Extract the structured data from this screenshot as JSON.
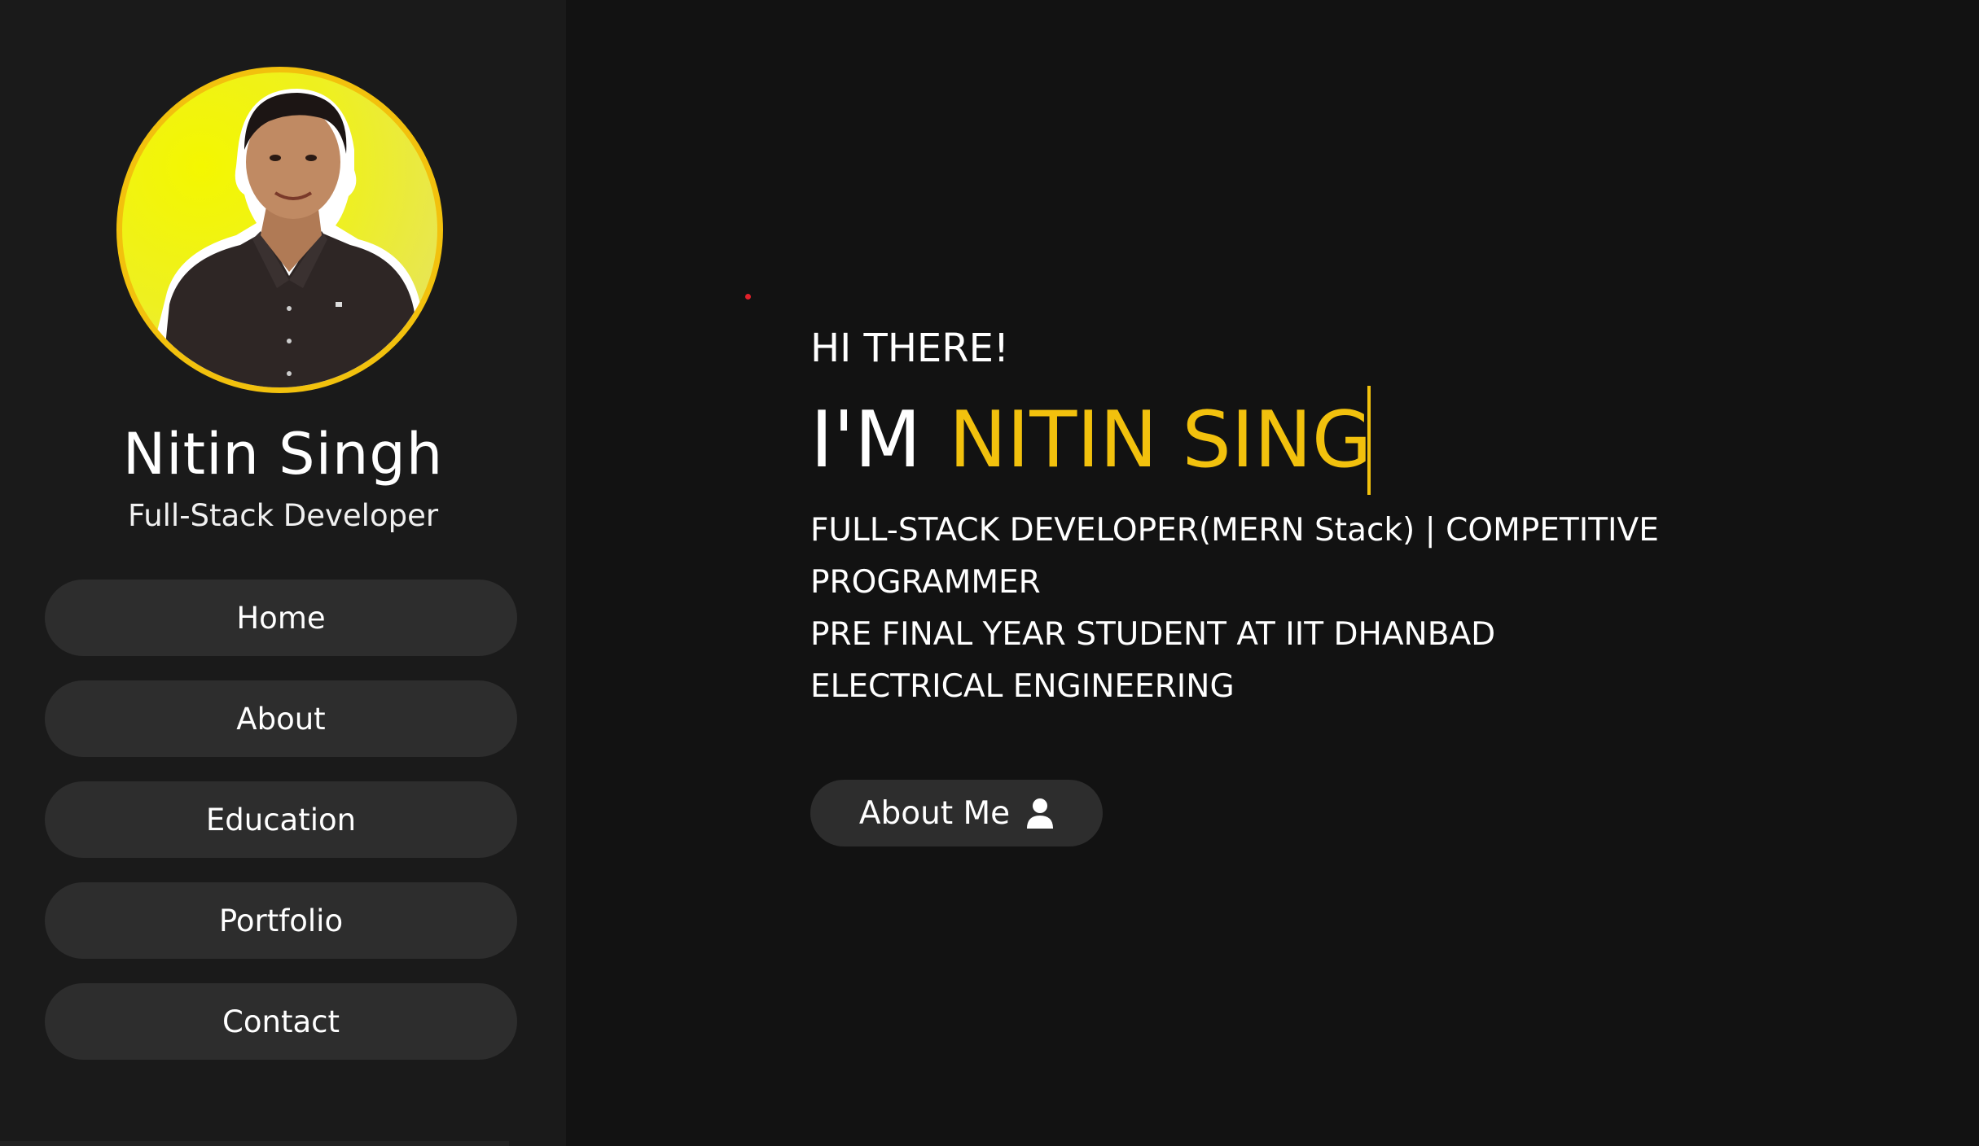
{
  "sidebar": {
    "name": "Nitin Singh",
    "role": "Full-Stack Developer",
    "nav": [
      {
        "label": "Home"
      },
      {
        "label": "About"
      },
      {
        "label": "Education"
      },
      {
        "label": "Portfolio"
      },
      {
        "label": "Contact"
      }
    ]
  },
  "hero": {
    "greeting": "HI THERE!",
    "prefix": "I'M",
    "typed_name": "NITIN SING",
    "lines": [
      "FULL-STACK DEVELOPER(MERN Stack) | COMPETITIVE PROGRAMMER",
      "PRE FINAL YEAR STUDENT AT IIT DHANBAD",
      "ELECTRICAL ENGINEERING"
    ],
    "button_label": "About Me",
    "button_icon": "user-icon"
  },
  "colors": {
    "accent": "#f2c10d",
    "background": "#121212",
    "sidebar": "#1a1a1a",
    "button": "#2d2d2d"
  }
}
